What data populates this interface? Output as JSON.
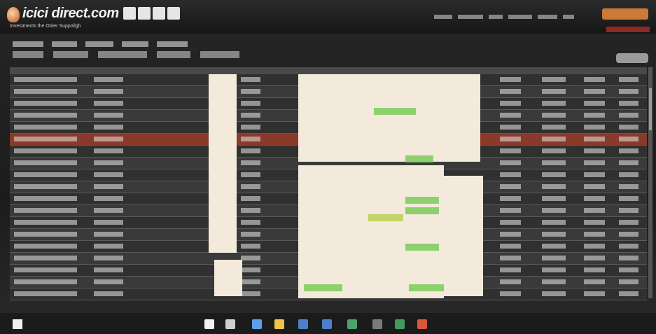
{
  "app": {
    "logo_text": "icici direct.com",
    "logo_tagline": "Investments the Ooler Suppollgh"
  },
  "taskbar": {
    "apps": [
      {
        "name": "cortana-icon",
        "color": "#f2f2f2"
      },
      {
        "name": "taskview-icon",
        "color": "#cfcfcf"
      },
      {
        "name": "edge-icon",
        "color": "#5aa0e6"
      },
      {
        "name": "explorer-icon",
        "color": "#f0c24a"
      },
      {
        "name": "store-icon",
        "color": "#4d7fc9"
      },
      {
        "name": "mail-icon",
        "color": "#4d7fc9"
      },
      {
        "name": "chrome-icon",
        "color": "#4aa36b"
      },
      {
        "name": "settings-icon",
        "color": "#7a7a7a"
      },
      {
        "name": "excel-icon",
        "color": "#3f9c5a"
      },
      {
        "name": "office-icon",
        "color": "#d9563a"
      }
    ]
  },
  "colors": {
    "header_bg": "#161616",
    "accent_orange": "#e98a3b",
    "accent_red": "#c2332b",
    "grid_row": "#303030",
    "grid_row_alt": "#3a3a3a",
    "highlight_row": "#8a3a2a",
    "pale_block": "#f3eadb",
    "positive_green": "#7acc5a"
  }
}
